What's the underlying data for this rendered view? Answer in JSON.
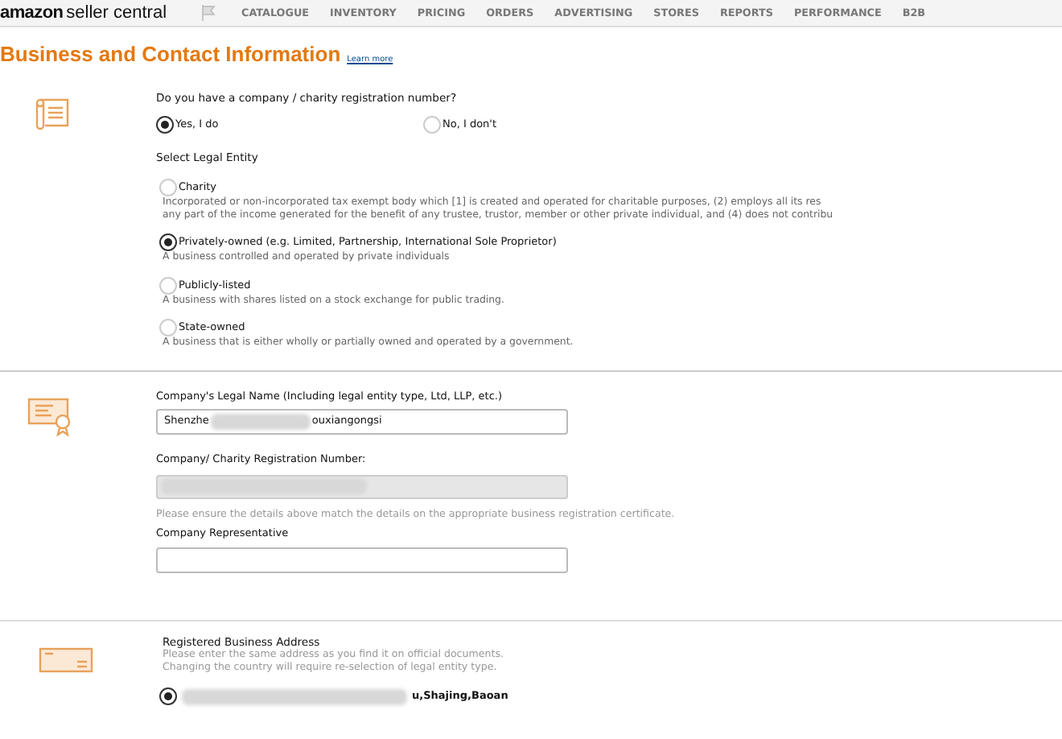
{
  "header": {
    "logo_brand": "amazon",
    "logo_product": "seller central",
    "nav": [
      "CATALOGUE",
      "INVENTORY",
      "PRICING",
      "ORDERS",
      "ADVERTISING",
      "STORES",
      "REPORTS",
      "PERFORMANCE",
      "B2B"
    ]
  },
  "page": {
    "title": "Business and Contact Information",
    "learn_more": "Learn more"
  },
  "registration": {
    "question": "Do you have a company / charity registration number?",
    "options": [
      {
        "label": "Yes, I do",
        "selected": true
      },
      {
        "label": "No, I don't",
        "selected": false
      }
    ],
    "entity_label": "Select Legal Entity",
    "entities": [
      {
        "label": "Charity",
        "description": [
          "Incorporated or non-incorporated tax exempt body which [1] is created and operated for charitable purposes, (2) employs all its res",
          "any part of the income generated for the benefit of any trustee, trustor, member or other private individual, and (4) does not contribu"
        ],
        "selected": false
      },
      {
        "label": "Privately-owned (e.g. Limited, Partnership, International Sole Proprietor)",
        "description": [
          "A business controlled and operated by private individuals"
        ],
        "selected": true
      },
      {
        "label": "Publicly-listed",
        "description": [
          "A business with shares listed on a stock exchange for public trading."
        ],
        "selected": false
      },
      {
        "label": "State-owned",
        "description": [
          "A business that is either wholly or partially owned and operated by a government."
        ],
        "selected": false
      }
    ]
  },
  "company": {
    "legal_name_label": "Company's Legal Name (Including legal entity type, Ltd, LLP, etc.)",
    "legal_name_start": "Shenzhe",
    "legal_name_end": "ouxiangongsi",
    "reg_number_label": "Company/ Charity Registration Number:",
    "notice": "Please ensure the details above match the details on the appropriate business registration certificate.",
    "representative_label": "Company Representative"
  },
  "address": {
    "title": "Registered Business Address",
    "hint": [
      "Please enter the same address as you find it on official documents.",
      "Changing the country will require re-selection of legal entity type."
    ],
    "options": [
      {
        "text_end": "u,Shajing,Baoan",
        "selected": true
      }
    ]
  }
}
